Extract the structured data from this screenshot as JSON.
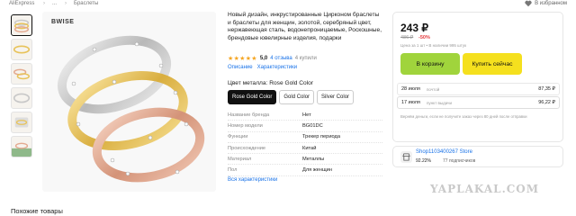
{
  "breadcrumbs": [
    "AliExpress",
    "...",
    "Браслеты"
  ],
  "favorite_label": "В избранном",
  "product": {
    "brand_on_image": "BWISE",
    "title": "Новый дизайн, инкрустированные Цирконом браслеты и браслеты для женщин, золотой, серебряный цвет, нержавеющая сталь, водонепроницаемые, Роскошные, брендовые ювелирные изделия, подарки",
    "rating": "5,0",
    "stars": "★★★★★",
    "reviews": "4 отзыва",
    "bought": "4 купили",
    "tabs": [
      "Описание",
      "Характеристики"
    ],
    "color_label": "Цвет металла: Rose Gold Color",
    "variants": [
      {
        "label": "Rose Gold Color",
        "selected": true
      },
      {
        "label": "Gold Color",
        "selected": false
      },
      {
        "label": "Silver Color",
        "selected": false
      }
    ],
    "specs": [
      {
        "key": "Название бренда",
        "value": "Нет"
      },
      {
        "key": "Номер модели",
        "value": "BG01DC"
      },
      {
        "key": "Функции",
        "value": "Трекер периода"
      },
      {
        "key": "Происхождение",
        "value": "Китай"
      },
      {
        "key": "Материал",
        "value": "Металлы"
      },
      {
        "key": "Пол",
        "value": "Для женщин"
      }
    ],
    "all_specs_link": "Вся характеристики"
  },
  "buybox": {
    "price": "243 ₽",
    "old_price": "486 ₽",
    "discount": "-50%",
    "price_note": "Цена за 1 шт • В наличии 995 штук",
    "cart_button": "В корзину",
    "buy_button": "Купить сейчас",
    "delivery": [
      {
        "date": "28 июля",
        "type": "почтой",
        "price": "87,35 ₽"
      },
      {
        "date": "17 июля",
        "type": "пункт выдачи",
        "price": "96,22 ₽"
      }
    ],
    "refund_note": "Вернём деньги, если не получите заказ через 80 дней после отправки"
  },
  "store": {
    "name": "Shop1103400267 Store",
    "rating": "92.22%",
    "subscribers": "77 подписчиков"
  },
  "watermark": "YAPLAKAL.COM",
  "similar_heading": "Похожие товары",
  "colors": {
    "cart_button": "#a0d43c",
    "buy_button": "#f5e01e",
    "link": "#1a73e8",
    "discount": "#e4393c",
    "star": "#f5a623",
    "silver": "#c8c8c8",
    "gold": "#e8c35a",
    "rose_gold": "#e3a98f"
  }
}
